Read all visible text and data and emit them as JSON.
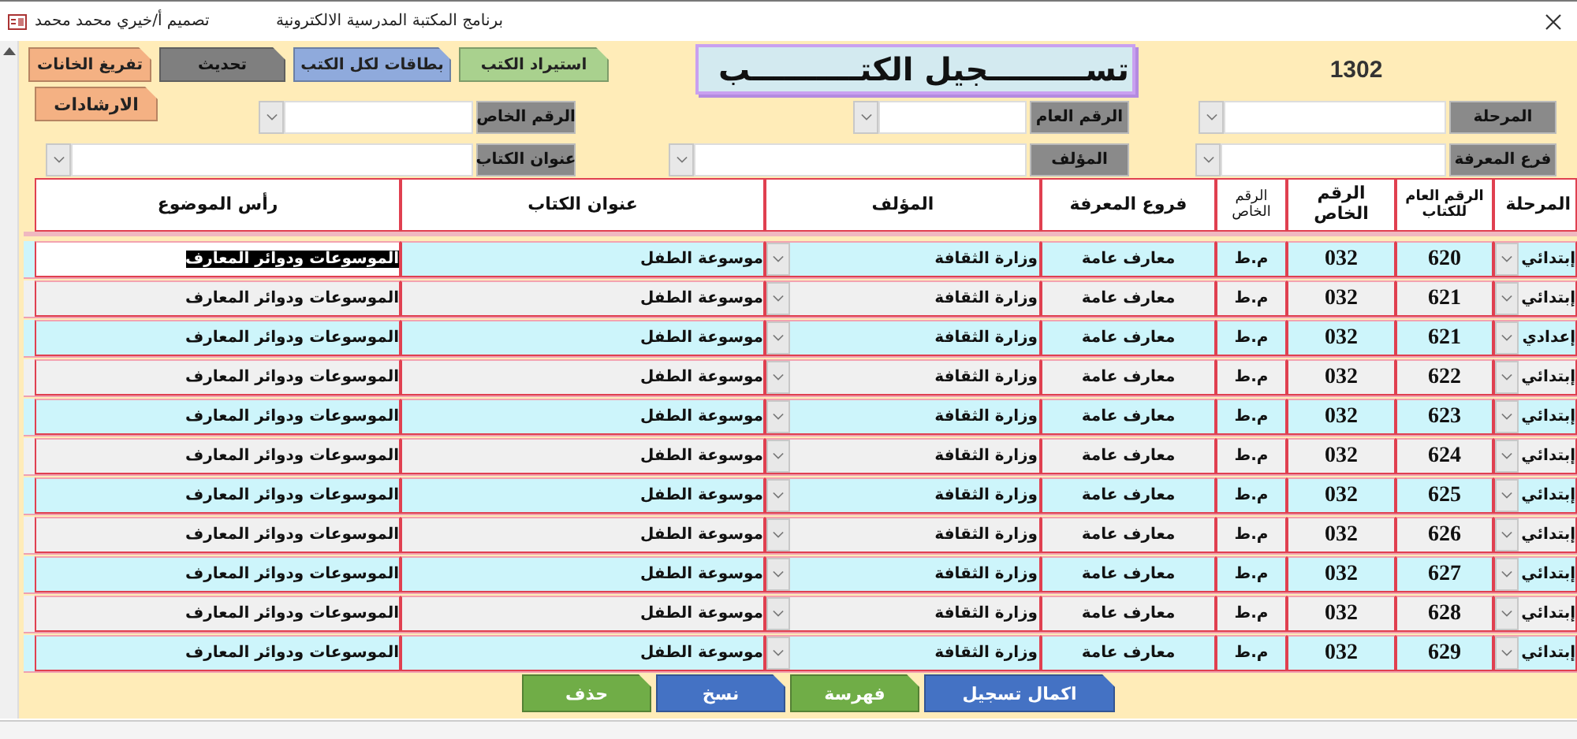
{
  "window": {
    "title": "برنامج المكتبة المدرسية الالكترونية",
    "designer": "تصميم أ/خيري محمد محمد"
  },
  "header": {
    "record_count": "1302",
    "form_title": "تســـــــــجيل الكتــــــــــب"
  },
  "top_buttons": [
    {
      "label": "استيراد الكتب",
      "color": "#a9d18e"
    },
    {
      "label": "بطاقات لكل الكتب",
      "color": "#8faadc"
    },
    {
      "label": "تحديث",
      "color": "#7f7f7f"
    },
    {
      "label": "تفريغ الخانات",
      "color": "#f4b183"
    }
  ],
  "help_button": {
    "label": "الارشادات",
    "color": "#f4b183"
  },
  "filter_rows": [
    [
      {
        "label": "المرحلة"
      },
      {
        "label": "الرقم العام"
      },
      {
        "label": "الرقم الخاص"
      }
    ],
    [
      {
        "label": "فرع المعرفة"
      },
      {
        "label": "المؤلف"
      },
      {
        "label": "عنوان الكتاب"
      }
    ]
  ],
  "table": {
    "columns": [
      {
        "label": "المرحلة",
        "kind": "combo"
      },
      {
        "label": "الرقم العام للكتاب",
        "kind": "number"
      },
      {
        "label": "الرقم الخاص",
        "kind": "number"
      },
      {
        "label": "الرقم الخاص",
        "kind": "small"
      },
      {
        "label": "فروع المعرفة",
        "kind": "text"
      },
      {
        "label": "المؤلف",
        "kind": "combo"
      },
      {
        "label": "عنوان الكتاب",
        "kind": "text"
      },
      {
        "label": "رأس الموضوع",
        "kind": "text"
      }
    ],
    "rows": [
      {
        "selected": true,
        "cells": [
          "إبتدائي",
          "620",
          "032",
          "م.ط",
          "معارف عامة",
          "وزارة الثقافة",
          "موسوعة الطفل",
          "الموسوعات ودوائر المعارف"
        ]
      },
      {
        "selected": false,
        "cells": [
          "إبتدائي",
          "621",
          "032",
          "م.ط",
          "معارف عامة",
          "وزارة الثقافة",
          "موسوعة الطفل",
          "الموسوعات ودوائر المعارف"
        ]
      },
      {
        "selected": false,
        "cells": [
          "إعدادي",
          "621",
          "032",
          "م.ط",
          "معارف عامة",
          "وزارة الثقافة",
          "موسوعة الطفل",
          "الموسوعات ودوائر المعارف"
        ]
      },
      {
        "selected": false,
        "cells": [
          "إبتدائي",
          "622",
          "032",
          "م.ط",
          "معارف عامة",
          "وزارة الثقافة",
          "موسوعة الطفل",
          "الموسوعات ودوائر المعارف"
        ]
      },
      {
        "selected": false,
        "cells": [
          "إبتدائي",
          "623",
          "032",
          "م.ط",
          "معارف عامة",
          "وزارة الثقافة",
          "موسوعة الطفل",
          "الموسوعات ودوائر المعارف"
        ]
      },
      {
        "selected": false,
        "cells": [
          "إبتدائي",
          "624",
          "032",
          "م.ط",
          "معارف عامة",
          "وزارة الثقافة",
          "موسوعة الطفل",
          "الموسوعات ودوائر المعارف"
        ]
      },
      {
        "selected": false,
        "cells": [
          "إبتدائي",
          "625",
          "032",
          "م.ط",
          "معارف عامة",
          "وزارة الثقافة",
          "موسوعة الطفل",
          "الموسوعات ودوائر المعارف"
        ]
      },
      {
        "selected": false,
        "cells": [
          "إبتدائي",
          "626",
          "032",
          "م.ط",
          "معارف عامة",
          "وزارة الثقافة",
          "موسوعة الطفل",
          "الموسوعات ودوائر المعارف"
        ]
      },
      {
        "selected": false,
        "cells": [
          "إبتدائي",
          "627",
          "032",
          "م.ط",
          "معارف عامة",
          "وزارة الثقافة",
          "موسوعة الطفل",
          "الموسوعات ودوائر المعارف"
        ]
      },
      {
        "selected": false,
        "cells": [
          "إبتدائي",
          "628",
          "032",
          "م.ط",
          "معارف عامة",
          "وزارة الثقافة",
          "موسوعة الطفل",
          "الموسوعات ودوائر المعارف"
        ]
      },
      {
        "selected": false,
        "cells": [
          "إبتدائي",
          "629",
          "032",
          "م.ط",
          "معارف عامة",
          "وزارة الثقافة",
          "موسوعة الطفل",
          "الموسوعات ودوائر المعارف"
        ]
      }
    ]
  },
  "bottom_buttons": [
    {
      "label": "اكمال تسجيل",
      "color": "#4472c4"
    },
    {
      "label": "فهرسة",
      "color": "#70ad47"
    },
    {
      "label": "نسخ",
      "color": "#4472c4"
    },
    {
      "label": "حذف",
      "color": "#70ad47"
    }
  ]
}
